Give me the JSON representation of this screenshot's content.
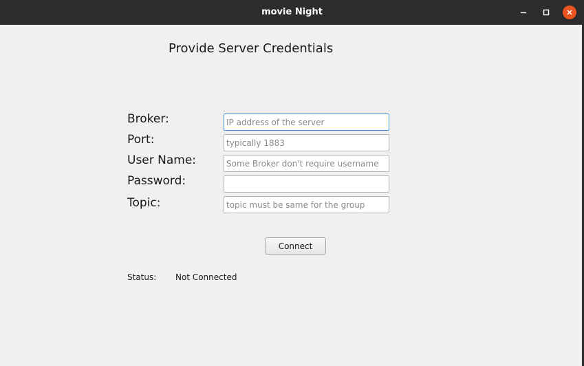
{
  "window": {
    "title": "movie Night",
    "accent_close": "#e95420",
    "titlebar_color": "#2c2c2c"
  },
  "form": {
    "heading": "Provide Server Credentials",
    "fields": [
      {
        "label": "Broker:",
        "value": "",
        "placeholder": "IP address of the server"
      },
      {
        "label": "Port:",
        "value": "",
        "placeholder": "typically 1883"
      },
      {
        "label": "User Name:",
        "value": "",
        "placeholder": "Some Broker don't require username"
      },
      {
        "label": "Password:",
        "value": "",
        "placeholder": ""
      },
      {
        "label": "Topic:",
        "value": "",
        "placeholder": "topic must be same for the group"
      }
    ],
    "connect_label": "Connect",
    "status_label": "Status:",
    "status_value": "Not Connected"
  },
  "icons": {
    "minimize": "minimize-icon",
    "maximize": "maximize-icon",
    "close": "close-icon"
  }
}
